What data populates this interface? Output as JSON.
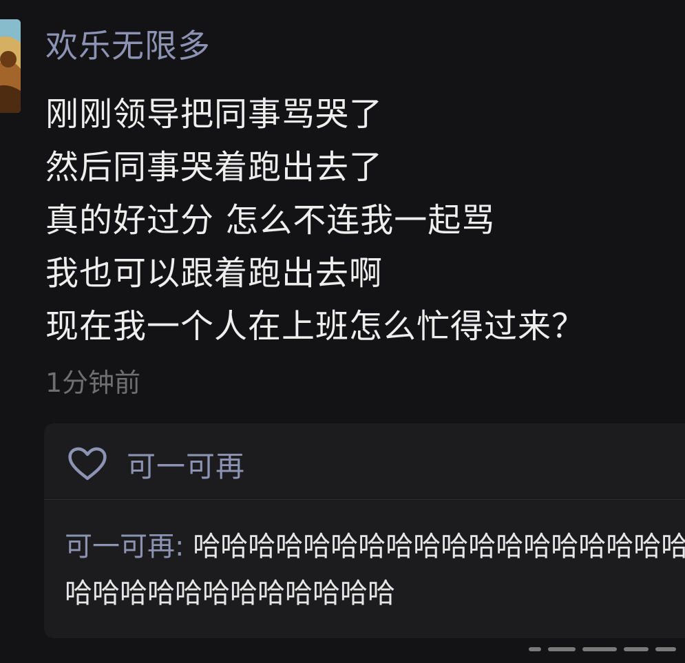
{
  "post": {
    "username": "欢乐无限多",
    "lines": [
      "刚刚领导把同事骂哭了",
      "然后同事哭着跑出去了",
      "真的好过分 怎么不连我一起骂",
      "我也可以跟着跑出去啊",
      "现在我一个人在上班怎么忙得过来？"
    ],
    "timestamp": "1分钟前"
  },
  "like": {
    "icon": "heart-outline-icon",
    "name": "可一可再"
  },
  "reply": {
    "author": "可一可再",
    "separator": ": ",
    "text": "哈哈哈哈哈哈哈哈哈哈哈哈哈哈哈哈哈哈哈哈哈哈哈哈哈哈哈哈哈哈哈哈哈哈"
  },
  "colors": {
    "background": "#131315",
    "username": "#8c93b3",
    "body_text": "#eeeeee",
    "muted": "#6e6e73",
    "card": "#1c1c1f"
  }
}
